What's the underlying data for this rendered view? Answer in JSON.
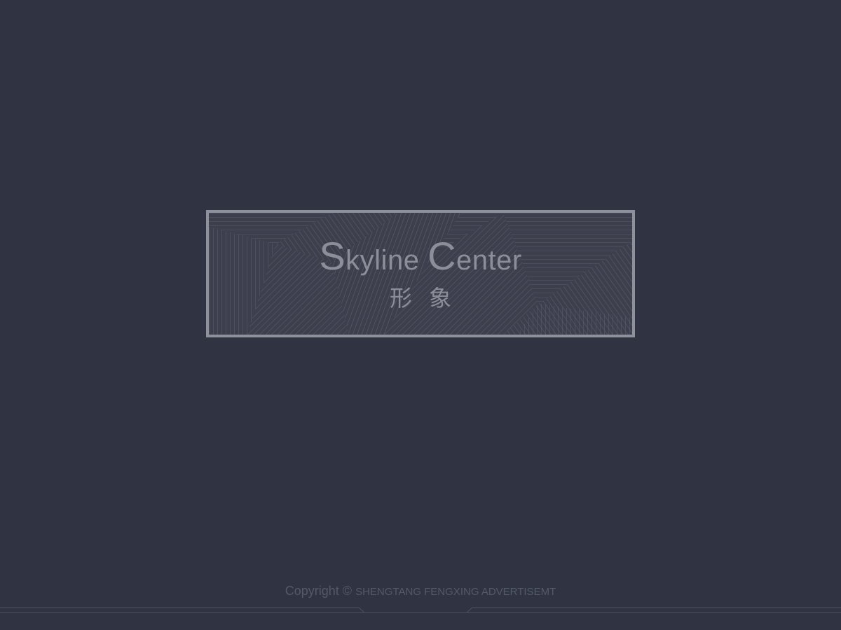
{
  "logo": {
    "title_first_initial": "S",
    "title_first_rest": "kyline ",
    "title_second_initial": "C",
    "title_second_rest": "enter",
    "subtitle": "形象"
  },
  "footer": {
    "copyright_prefix": "Copyright © ",
    "copyright_owner": "SHENGTANG FENGXING ADVERTISEMT"
  },
  "colors": {
    "background": "#303442",
    "frame": "#8d919b",
    "logo_text": "#8b8f99",
    "footer_text": "#545968"
  }
}
